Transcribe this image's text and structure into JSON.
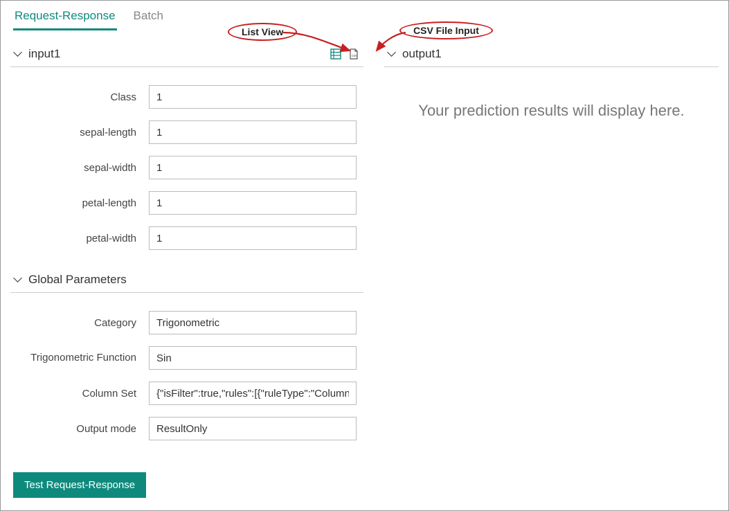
{
  "tabs": {
    "request_response": "Request-Response",
    "batch": "Batch"
  },
  "callouts": {
    "list_view": "List View",
    "csv_file_input": "CSV File Input"
  },
  "input_section": {
    "title": "input1",
    "fields": {
      "class": {
        "label": "Class",
        "value": "1"
      },
      "sepal_length": {
        "label": "sepal-length",
        "value": "1"
      },
      "sepal_width": {
        "label": "sepal-width",
        "value": "1"
      },
      "petal_length": {
        "label": "petal-length",
        "value": "1"
      },
      "petal_width": {
        "label": "petal-width",
        "value": "1"
      }
    }
  },
  "global_params": {
    "title": "Global Parameters",
    "fields": {
      "category": {
        "label": "Category",
        "value": "Trigonometric"
      },
      "trig_func": {
        "label": "Trigonometric Function",
        "value": "Sin"
      },
      "column_set": {
        "label": "Column Set",
        "value": "{\"isFilter\":true,\"rules\":[{\"ruleType\":\"ColumnTy"
      },
      "output_mode": {
        "label": "Output mode",
        "value": "ResultOnly"
      }
    }
  },
  "output_section": {
    "title": "output1",
    "placeholder": "Your prediction results will display here."
  },
  "buttons": {
    "test": "Test Request-Response"
  },
  "icons": {
    "list_view": "list-view-icon",
    "csv_input": "csv-file-icon"
  }
}
